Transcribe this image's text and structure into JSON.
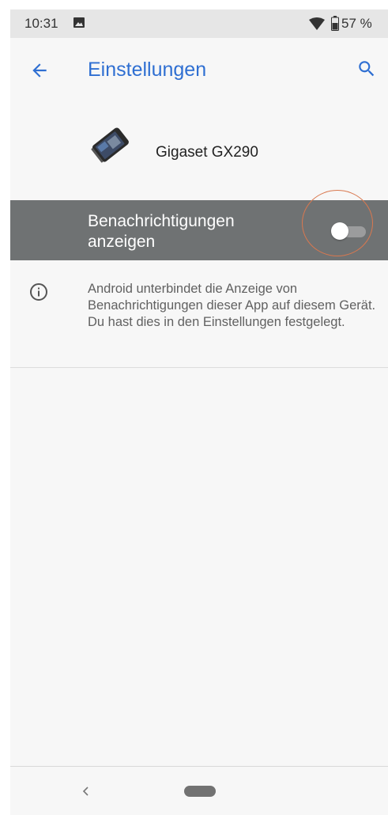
{
  "status_bar": {
    "time": "10:31",
    "battery": "57 %",
    "image_icon": "image-icon",
    "wifi_icon": "wifi-icon",
    "battery_icon": "battery-icon"
  },
  "app_bar": {
    "title": "Einstellungen",
    "back_icon": "arrow-back-icon",
    "search_icon": "search-icon",
    "accent_color": "#2f6fd2"
  },
  "app_header": {
    "name": "Gigaset GX290",
    "icon": "phone-icon"
  },
  "notification_toggle": {
    "label": "Benachrichtigungen anzeigen",
    "state": "off",
    "row_color": "#6f7273"
  },
  "info": {
    "icon": "info-icon",
    "text": "Android unterbindet die Anzeige von Benachrichtigungen dieser App auf diesem Gerät. Du hast dies in den Einstellungen festgelegt."
  },
  "nav_bar": {
    "back_icon": "nav-back-icon",
    "home_icon": "home-pill-icon"
  }
}
